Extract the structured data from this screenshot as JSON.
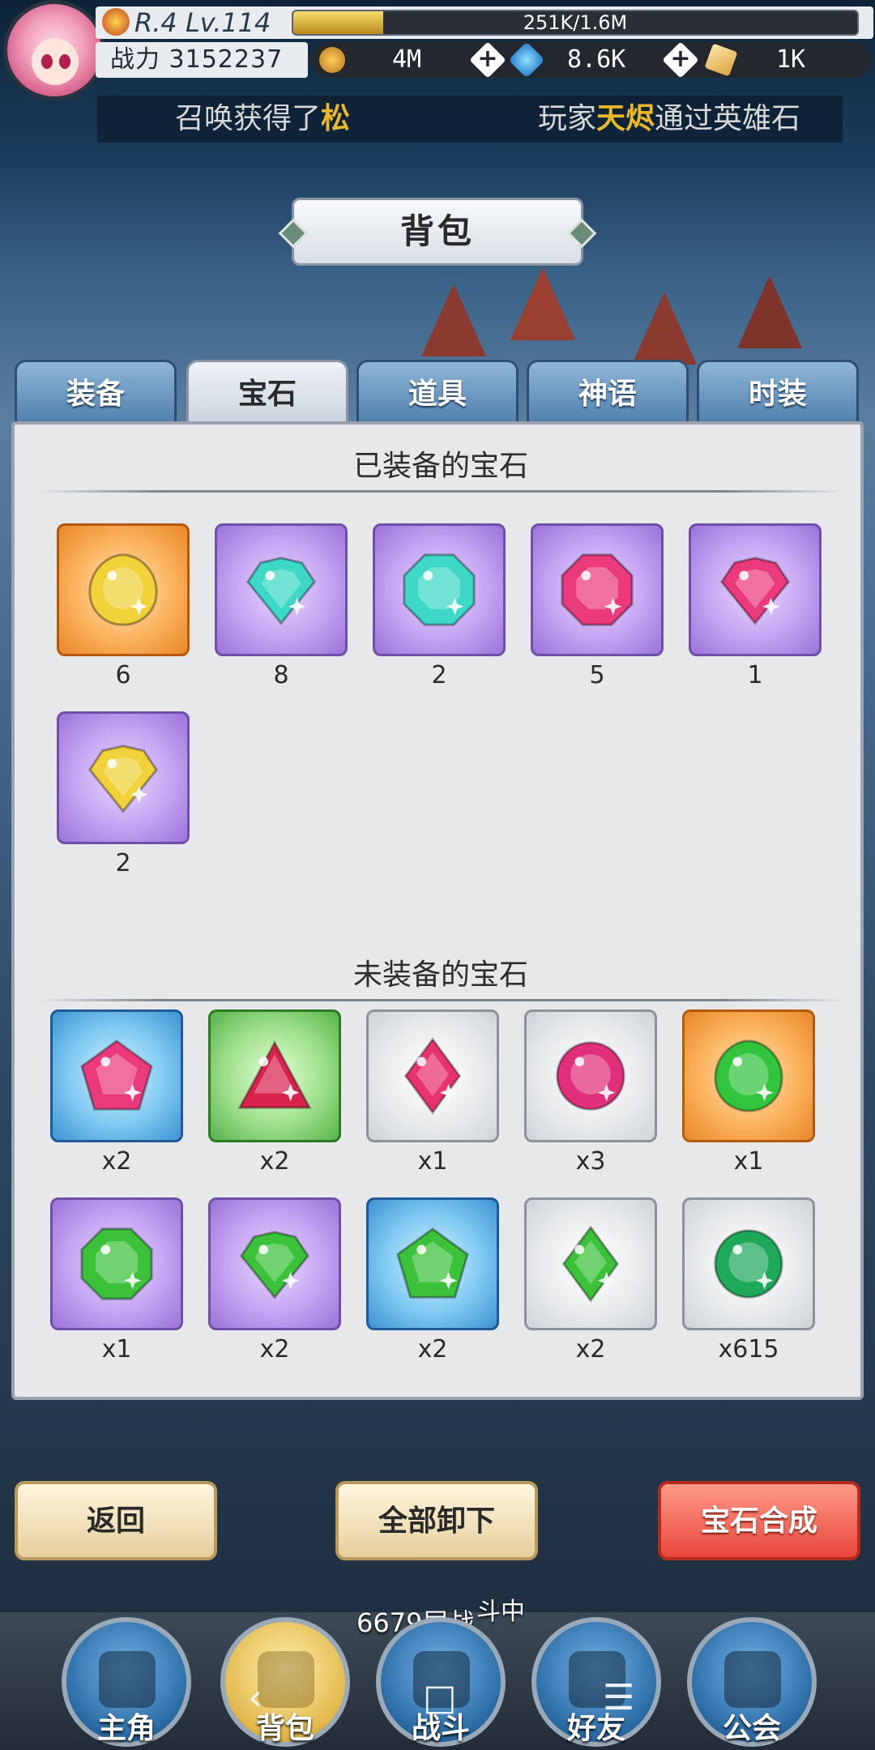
{
  "player": {
    "rank_level": "R.4 Lv.114",
    "exp_text": "251K/1.6M",
    "exp_progress": 0.16,
    "power_label": "战力",
    "power_value": "3152237"
  },
  "currencies": {
    "gold": "4M",
    "diamond": "8.6K",
    "scroll": "1K"
  },
  "ticker": {
    "msg1_a": "召唤获得了",
    "msg1_b": "松",
    "msg2_a": "玩家",
    "msg2_b": "天烬",
    "msg2_c": "通过英雄石"
  },
  "title": "背包",
  "tabs": [
    "装备",
    "宝石",
    "道具",
    "神语",
    "时装"
  ],
  "active_tab": "宝石",
  "equipped": {
    "header": "已装备的宝石",
    "items": [
      {
        "count": "6",
        "frame": "orange",
        "color": "#f2d23a",
        "shape": "round"
      },
      {
        "count": "8",
        "frame": "purple",
        "color": "#3ed8c6",
        "shape": "heart"
      },
      {
        "count": "2",
        "frame": "purple",
        "color": "#3ed8c6",
        "shape": "octagon"
      },
      {
        "count": "5",
        "frame": "purple",
        "color": "#ea3a7c",
        "shape": "octagon"
      },
      {
        "count": "1",
        "frame": "purple",
        "color": "#ea3a7c",
        "shape": "heart"
      },
      {
        "count": "2",
        "frame": "purple",
        "color": "#f2d23a",
        "shape": "heart"
      }
    ]
  },
  "unequipped": {
    "header": "未装备的宝石",
    "items": [
      {
        "count": "x2",
        "frame": "blue",
        "color": "#ea3a7c",
        "shape": "pentagon"
      },
      {
        "count": "x2",
        "frame": "green",
        "color": "#d9234f",
        "shape": "triangle"
      },
      {
        "count": "x1",
        "frame": "white",
        "color": "#e8336f",
        "shape": "diamond"
      },
      {
        "count": "x3",
        "frame": "white",
        "color": "#e0307a",
        "shape": "circle"
      },
      {
        "count": "x1",
        "frame": "orange",
        "color": "#32c43c",
        "shape": "round"
      },
      {
        "count": "x1",
        "frame": "purple",
        "color": "#3bc23a",
        "shape": "octagon"
      },
      {
        "count": "x2",
        "frame": "purple",
        "color": "#3bc23a",
        "shape": "heart"
      },
      {
        "count": "x2",
        "frame": "blue",
        "color": "#3bc23a",
        "shape": "pentagon"
      },
      {
        "count": "x2",
        "frame": "white",
        "color": "#3bc23a",
        "shape": "diamond"
      },
      {
        "count": "x615",
        "frame": "white",
        "color": "#1ea85a",
        "shape": "circle"
      }
    ]
  },
  "buttons": {
    "back": "返回",
    "unequip_all": "全部卸下",
    "synthesize": "宝石合成"
  },
  "status": {
    "floor": "6679层战",
    "battle": "斗中"
  },
  "nav": [
    "主角",
    "背包",
    "战斗",
    "好友",
    "公会"
  ],
  "active_nav": "背包",
  "system_nav": {
    "back": "‹",
    "home": "□",
    "menu": "☰"
  }
}
